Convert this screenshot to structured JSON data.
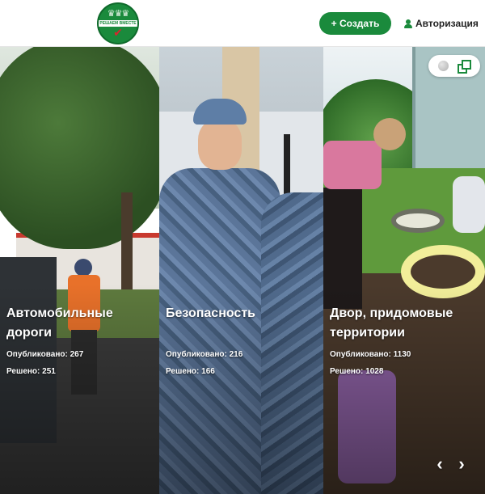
{
  "header": {
    "logo_text": "РЕШАЕМ ВМЕСТЕ",
    "create_button": "+ Создать",
    "auth_link": "Авторизация"
  },
  "categories": [
    {
      "title": "Автомобильные дороги",
      "published": "Опубликовано: 267",
      "solved": "Решено: 251"
    },
    {
      "title": "Безопасность",
      "published": "Опубликовано: 216",
      "solved": "Решено: 166"
    },
    {
      "title": "Двор, придомовые территории",
      "published": "Опубликовано: 1130",
      "solved": "Решено: 1028"
    }
  ],
  "slider": {
    "prev_label": "‹",
    "next_label": "›"
  },
  "icons": {
    "logo": "logo-emblem",
    "create": "plus-icon",
    "auth": "user-icon",
    "globe": "globe-icon",
    "windows": "windows-icon",
    "prev": "chevron-left-icon",
    "next": "chevron-right-icon"
  },
  "colors": {
    "brand_green": "#1a8a3c",
    "logo_red": "#d8262e",
    "text_dark": "#222222",
    "header_bg": "#ffffff"
  }
}
